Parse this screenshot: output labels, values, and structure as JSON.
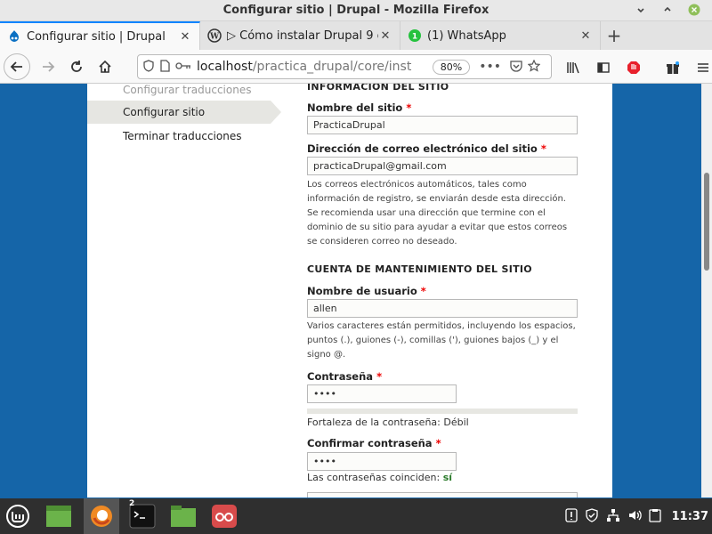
{
  "window": {
    "title": "Configurar sitio | Drupal - Mozilla Firefox"
  },
  "tabs": [
    {
      "label": "Configurar sitio | Drupal",
      "icon": "drupal-icon",
      "active": true
    },
    {
      "label": "▷ Cómo instalar Drupal 9 e",
      "icon": "wordpress-icon",
      "active": false
    },
    {
      "label": "(1) WhatsApp",
      "icon": "whatsapp-icon",
      "active": false
    }
  ],
  "navbar": {
    "url_host": "localhost",
    "url_path": "/practica_drupal/core/inst",
    "zoom": "80%"
  },
  "sidebar": {
    "steps": [
      {
        "label": "Configurar traducciones",
        "state": "done"
      },
      {
        "label": "Configurar sitio",
        "state": "active"
      },
      {
        "label": "Terminar traducciones",
        "state": "todo"
      }
    ]
  },
  "form": {
    "site_section": "INFORMACIÓN DEL SITIO",
    "site_name_label": "Nombre del sitio",
    "site_name_value": "PracticaDrupal",
    "email_label": "Dirección de correo electrónico del sitio",
    "email_value": "practicaDrupal@gmail.com",
    "email_desc": "Los correos electrónicos automáticos, tales como información de registro, se enviarán desde esta dirección. Se recomienda usar una dirección que termine con el dominio de su sitio para ayudar a evitar que estos correos se consideren correo no deseado.",
    "maint_section": "CUENTA DE MANTENIMIENTO DEL SITIO",
    "username_label": "Nombre de usuario",
    "username_value": "allen",
    "username_desc": "Varios caracteres están permitidos, incluyendo los espacios, puntos (.), guiones (-), comillas ('), guiones bajos (_) y el signo @.",
    "password_label": "Contraseña",
    "password_value": "••••",
    "strength_prefix": "Fortaleza de la contraseña: ",
    "strength_value": "Débil",
    "confirm_label": "Confirmar contraseña",
    "confirm_value": "••••",
    "match_prefix": "Las contraseñas coinciden: ",
    "match_value": "sí",
    "required_mark": "*"
  },
  "taskbar": {
    "badge": "2",
    "clock": "11:37"
  },
  "colors": {
    "accent": "#0a84ff",
    "desktop": "#1565a8",
    "required": "#e00000",
    "match": "#2a7a2a"
  }
}
